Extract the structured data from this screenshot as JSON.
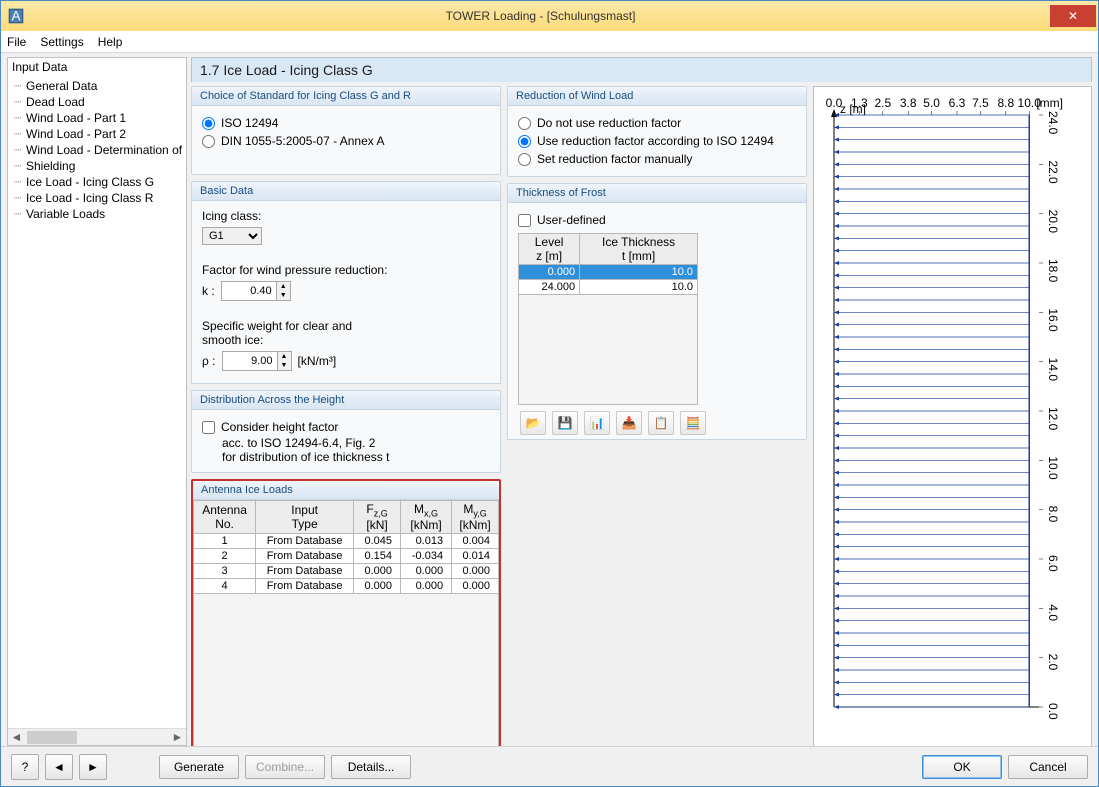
{
  "window": {
    "title": "TOWER Loading - [Schulungsmast]"
  },
  "menu": {
    "file": "File",
    "settings": "Settings",
    "help": "Help"
  },
  "sidebar": {
    "head": "Input Data",
    "items": [
      "General Data",
      "Dead Load",
      "Wind Load - Part 1",
      "Wind Load - Part 2",
      "Wind Load - Determination of G",
      "Shielding",
      "Ice Load - Icing Class G",
      "Ice Load - Icing Class R",
      "Variable Loads"
    ]
  },
  "page": {
    "title": "1.7 Ice Load - Icing Class G"
  },
  "standard": {
    "title": "Choice of Standard for Icing Class G and R",
    "opt1": "ISO 12494",
    "opt2": "DIN 1055-5:2005-07 - Annex A"
  },
  "basic": {
    "title": "Basic Data",
    "icingClassLabel": "Icing class:",
    "icingClassValue": "G1",
    "factorLabel": "Factor for wind pressure reduction:",
    "kLabel": "k :",
    "kValue": "0.40",
    "specificLabel1": "Specific weight for clear and",
    "specificLabel2": "smooth ice:",
    "rhoLabel": "ρ :",
    "rhoValue": "9.00",
    "rhoUnit": "[kN/m³]"
  },
  "dist": {
    "title": "Distribution Across the Height",
    "check1": "Consider height factor",
    "check2": "acc. to ISO 12494-6.4, Fig. 2",
    "check3": "for distribution of ice thickness t"
  },
  "reduction": {
    "title": "Reduction of Wind Load",
    "opt1": "Do not use reduction factor",
    "opt2": "Use reduction factor according to ISO 12494",
    "opt3": "Set reduction factor manually"
  },
  "frost": {
    "title": "Thickness of Frost",
    "userDefined": "User-defined",
    "col1a": "Level",
    "col1b": "z [m]",
    "col2a": "Ice Thickness",
    "col2b": "t [mm]",
    "rows": [
      {
        "z": "0.000",
        "t": "10.0",
        "sel": true
      },
      {
        "z": "24.000",
        "t": "10.0",
        "sel": false
      }
    ]
  },
  "antenna": {
    "title": "Antenna Ice Loads",
    "h1a": "Antenna",
    "h1b": "No.",
    "h2a": "Input",
    "h2b": "Type",
    "h3a": "Fz,G",
    "h3b": "[kN]",
    "h4a": "Mx,G",
    "h4b": "[kNm]",
    "h5a": "My,G",
    "h5b": "[kNm]",
    "rows": [
      {
        "no": "1",
        "type": "From Database",
        "f": "0.045",
        "mx": "0.013",
        "my": "0.004"
      },
      {
        "no": "2",
        "type": "From Database",
        "f": "0.154",
        "mx": "-0.034",
        "my": "0.014"
      },
      {
        "no": "3",
        "type": "From Database",
        "f": "0.000",
        "mx": "0.000",
        "my": "0.000"
      },
      {
        "no": "4",
        "type": "From Database",
        "f": "0.000",
        "mx": "0.000",
        "my": "0.000"
      }
    ]
  },
  "chart_data": {
    "type": "line",
    "x_axis": {
      "label": "[mm]",
      "ticks": [
        0.0,
        1.3,
        2.5,
        3.8,
        5.0,
        6.3,
        7.5,
        8.8,
        10.0
      ],
      "range": [
        0,
        10.5
      ]
    },
    "y_axis": {
      "label": "z [m]",
      "ticks": [
        0.0,
        2.0,
        4.0,
        6.0,
        8.0,
        10.0,
        12.0,
        14.0,
        16.0,
        18.0,
        20.0,
        22.0,
        24.0
      ],
      "range": [
        0,
        24
      ]
    },
    "series": [
      {
        "name": "Ice thickness t",
        "x": [
          10.0,
          10.0
        ],
        "y": [
          0.0,
          24.0
        ],
        "color": "#1a3fa0"
      }
    ],
    "fill_arrows": true
  },
  "footer": {
    "generate": "Generate",
    "combine": "Combine...",
    "details": "Details...",
    "ok": "OK",
    "cancel": "Cancel"
  }
}
